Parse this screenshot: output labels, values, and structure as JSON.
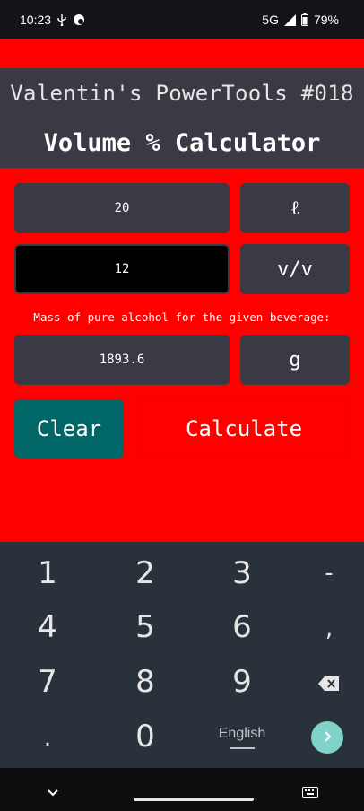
{
  "status_bar": {
    "time": "10:23",
    "network": "5G",
    "battery": "79%"
  },
  "header": {
    "app_title": "Valentin's PowerTools #018",
    "screen_title": "Volume % Calculator"
  },
  "form": {
    "volume": {
      "value": "20",
      "unit": "ℓ"
    },
    "percent": {
      "value": "12",
      "unit": "v/v"
    },
    "result_label": "Mass of pure alcohol for the given beverage:",
    "result": {
      "value": "1893.6",
      "unit": "g"
    }
  },
  "buttons": {
    "clear": "Clear",
    "calculate": "Calculate"
  },
  "keyboard": {
    "keys": [
      "1",
      "2",
      "3",
      "-",
      "4",
      "5",
      "6",
      ",",
      "7",
      "8",
      "9",
      ".",
      "0"
    ],
    "language": "English"
  },
  "colors": {
    "background": "#ff0000",
    "panel": "#3a3a44",
    "clear_button": "#006666",
    "keyboard": "#29323a",
    "go_button": "#7fd3c8"
  }
}
